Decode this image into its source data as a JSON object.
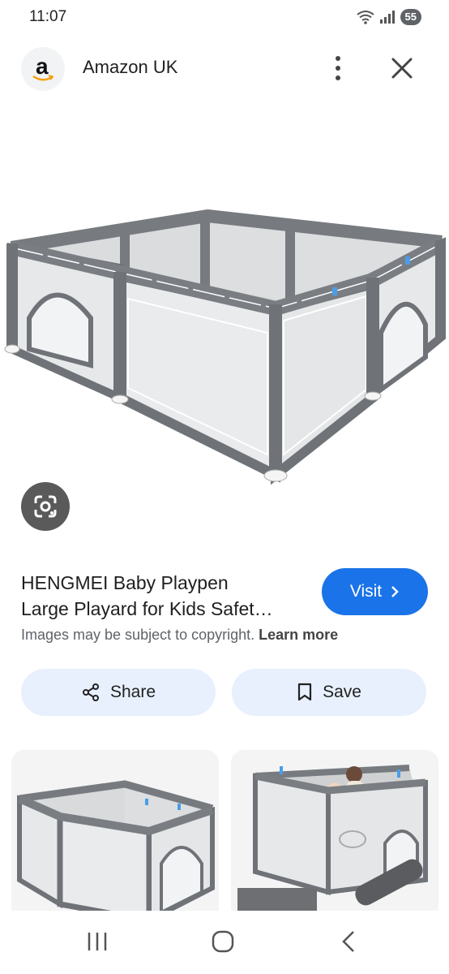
{
  "status": {
    "time": "11:07",
    "battery": "55"
  },
  "header": {
    "logo_letter": "a",
    "site_name": "Amazon UK"
  },
  "product": {
    "title_line1": "HENGMEI Baby Playpen",
    "title_line2": "Large Playard for Kids Safet…",
    "visit_label": "Visit",
    "copyright_text": "Images may be subject to copyright.",
    "learn_more": "Learn more"
  },
  "actions": {
    "share_label": "Share",
    "save_label": "Save"
  },
  "icons": [
    "wifi-icon",
    "signal-icon",
    "more-vert-icon",
    "close-icon",
    "google-lens-icon",
    "chevron-right-icon",
    "share-icon",
    "bookmark-icon",
    "recent-apps-icon",
    "home-icon",
    "back-icon"
  ],
  "colors": {
    "accent": "#1a73e8",
    "pill_bg": "#e8f0fe",
    "playpen_frame": "#6f7378",
    "playpen_mesh": "#dfe1e3"
  }
}
